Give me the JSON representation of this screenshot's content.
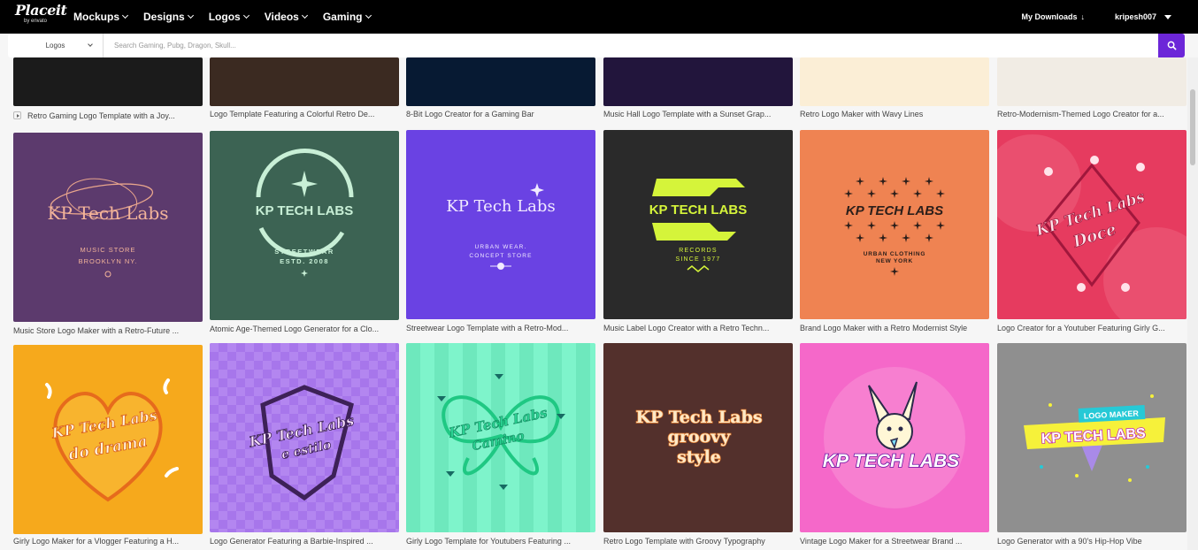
{
  "header": {
    "brand": "Placeit",
    "brand_sub": "by envato",
    "nav": [
      "Mockups",
      "Designs",
      "Logos",
      "Videos",
      "Gaming"
    ],
    "downloads": "My Downloads",
    "user": "kripesh007"
  },
  "search": {
    "category": "Logos",
    "placeholder": "Search Gaming, Pubg, Dragon, Skull..."
  },
  "row1": [
    {
      "caption": "Retro Gaming Logo Template with a Joy..."
    },
    {
      "caption": "Logo Template Featuring a Colorful Retro De..."
    },
    {
      "caption": "8-Bit Logo Creator for a Gaming Bar"
    },
    {
      "caption": "Music Hall Logo Template with a Sunset Grap..."
    },
    {
      "caption": "Retro Logo Maker with Wavy Lines"
    },
    {
      "caption": "Retro-Modernism-Themed Logo Creator for a..."
    }
  ],
  "row2": [
    {
      "caption": "Music Store Logo Maker with a Retro-Future ...",
      "logo": "KP Tech Labs",
      "line1": "MUSIC STORE",
      "line2": "BROOKLYN NY."
    },
    {
      "caption": "Atomic Age-Themed Logo Generator for a Clo...",
      "logo": "KP TECH LABS",
      "line1": "STREETWEAR",
      "line2": "ESTD. 2008"
    },
    {
      "caption": "Streetwear Logo Template with a Retro-Mod...",
      "logo": "KP Tech Labs",
      "line1": "URBAN WEAR.",
      "line2": "CONCEPT STORE"
    },
    {
      "caption": "Music Label Logo Creator with a Retro Techn...",
      "logo": "KP TECH LABS",
      "line1": "RECORDS",
      "line2": "SINCE 1977"
    },
    {
      "caption": "Brand Logo Maker with a Retro Modernist Style",
      "logo": "KP TECH LABS",
      "line1": "URBAN CLOTHING",
      "line2": "NEW YORK"
    },
    {
      "caption": "Logo Creator for a Youtuber Featuring Girly G...",
      "logo": "KP Tech Labs",
      "line1": "Doce",
      "line2": ""
    }
  ],
  "row3": [
    {
      "caption": "Girly Logo Maker for a Vlogger Featuring a H...",
      "logo": "KP Tech Labs",
      "line1": "do drama"
    },
    {
      "caption": "Logo Generator Featuring a Barbie-Inspired ...",
      "logo": "KP Tech Labs",
      "line1": "e estilo"
    },
    {
      "caption": "Girly Logo Template for Youtubers Featuring ...",
      "logo": "KP Tech Labs",
      "line1": "Camino"
    },
    {
      "caption": "Retro Logo Template with Groovy Typography",
      "logo": "KP Tech Labs",
      "line1": "groovy",
      "line2": "style"
    },
    {
      "caption": "Vintage Logo Maker for a Streetwear Brand ...",
      "logo": "KP TECH LABS"
    },
    {
      "caption": "Logo Generator with a 90's Hip-Hop Vibe",
      "logo": "KP TECH LABS",
      "line1": "LOGO MAKER"
    }
  ],
  "colors": {
    "accent": "#6c26d8"
  }
}
